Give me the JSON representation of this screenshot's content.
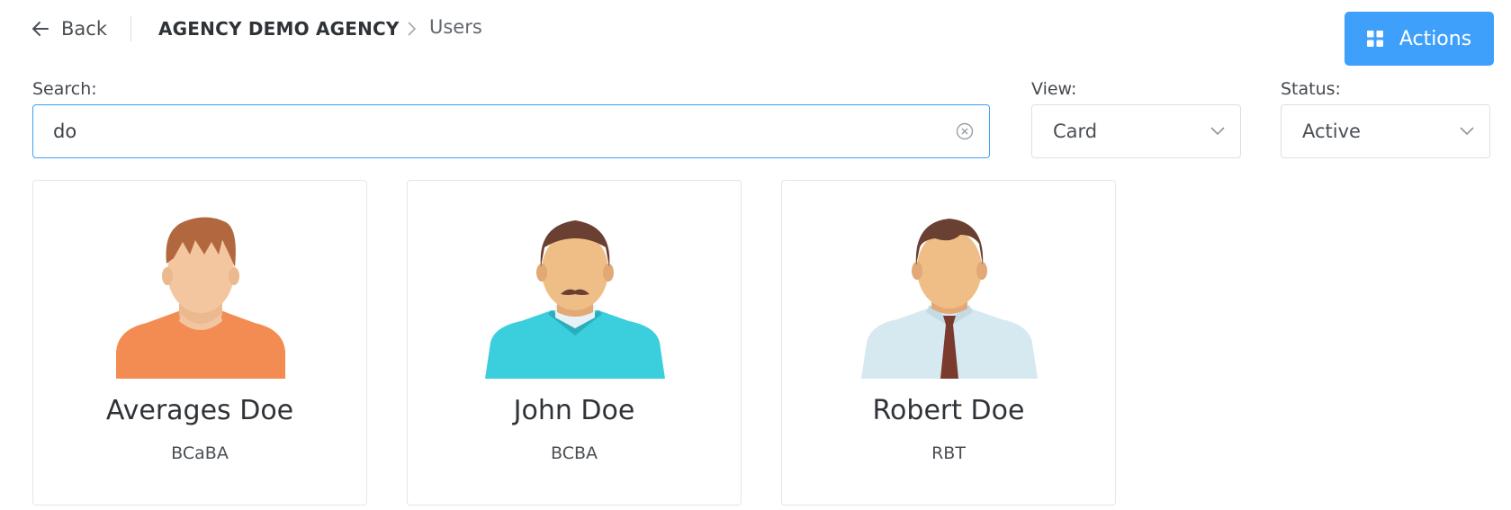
{
  "header": {
    "back_label": "Back",
    "breadcrumb": {
      "agency": "AGENCY DEMO AGENCY",
      "current": "Users"
    },
    "actions_label": "Actions"
  },
  "filters": {
    "search": {
      "label": "Search:",
      "value": "do"
    },
    "view": {
      "label": "View:",
      "selected": "Card"
    },
    "status": {
      "label": "Status:",
      "selected": "Active"
    }
  },
  "users": [
    {
      "name": "Averages Doe",
      "role": "BCaBA",
      "avatar_icon": "man-avatar-orange-shirt-icon"
    },
    {
      "name": "John Doe",
      "role": "BCBA",
      "avatar_icon": "man-avatar-mustache-icon"
    },
    {
      "name": "Robert Doe",
      "role": "RBT",
      "avatar_icon": "man-avatar-tie-icon"
    }
  ],
  "colors": {
    "accent": "#3ea0fb",
    "card_border": "#e3e6ea"
  }
}
